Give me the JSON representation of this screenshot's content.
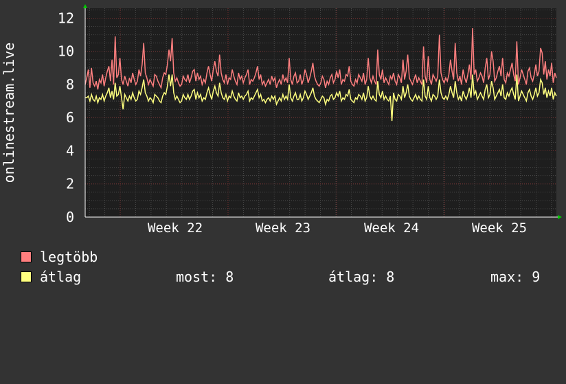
{
  "colors": {
    "background": "#333333",
    "plot_background": "#1e1e1e",
    "grid_minor": "#4a4a4a",
    "grid_major": "#7a3030",
    "axis_arrow": "#00cc00",
    "series_max": "#ff7f7f",
    "series_avg": "#ffff7f"
  },
  "legend": {
    "max_label": "legtöbb",
    "avg_label": "átlag",
    "stats": [
      {
        "label": "most: 8"
      },
      {
        "label": "átlag: 8"
      },
      {
        "label": "max: 9"
      }
    ]
  },
  "chart_data": {
    "type": "line",
    "xlabel": "",
    "ylabel": "onlinestream.live",
    "ylim": [
      0,
      12.6
    ],
    "yticks": [
      "0",
      "2",
      "4",
      "6",
      "8",
      "10",
      "12"
    ],
    "xticks": [
      "Week 22",
      "Week 23",
      "Week 24",
      "Week 25"
    ],
    "grid": true,
    "series": [
      {
        "name": "legtöbb",
        "values": [
          8,
          8.4,
          8.9,
          7.8,
          9,
          8.1,
          7.9,
          8.2,
          7.7,
          8.3,
          8.1,
          8.6,
          7.9,
          8.4,
          8.8,
          9.1,
          8.2,
          9.5,
          8.0,
          10.9,
          8.4,
          8.6,
          9.6,
          8.3,
          8.0,
          8.5,
          8.2,
          7.9,
          8.4,
          8.1,
          8.7,
          8.3,
          8.0,
          8.2,
          8.9,
          8.5,
          9.2,
          10.5,
          8.7,
          8.4,
          8.0,
          8.3,
          8.1,
          7.9,
          8.6,
          8.5,
          8.2,
          8.0,
          7.8,
          8.4,
          8.7,
          8.6,
          9.2,
          10.1,
          9.4,
          10.8,
          8.7,
          8.2,
          8.4,
          8.1,
          7.9,
          8.0,
          8.5,
          8.3,
          8.2,
          8.6,
          8.1,
          8.4,
          8.8,
          8.9,
          8.2,
          8.7,
          8.3,
          8.5,
          8.0,
          8.3,
          8.1,
          8.7,
          9.1,
          8.6,
          8.2,
          8.9,
          9.4,
          8.8,
          8.5,
          9.8,
          8.7,
          8.3,
          8.1,
          8.6,
          8.0,
          8.4,
          8.3,
          8.9,
          8.5,
          8.2,
          8.0,
          8.7,
          8.3,
          8.5,
          8.1,
          8.4,
          8.6,
          8.9,
          8.0,
          8.3,
          8.2,
          8.4,
          8.7,
          9.1,
          8.3,
          8.6,
          8.0,
          8.2,
          7.9,
          8.1,
          8.3,
          8.0,
          8.5,
          8.2,
          8.4,
          7.8,
          8.1,
          8.3,
          8.0,
          8.6,
          8.2,
          8.4,
          8.1,
          9.6,
          8.3,
          8.0,
          8.5,
          8.7,
          8.1,
          8.2,
          8.6,
          8.0,
          8.3,
          8.9,
          8.6,
          8.1,
          8.4,
          8.8,
          9.3,
          8.5,
          8.2,
          8.0,
          7.9,
          8.1,
          8.5,
          8.3,
          7.8,
          8.2,
          8.0,
          8.4,
          8.6,
          8.1,
          8.3,
          8.8,
          8.4,
          8.9,
          8.0,
          8.3,
          8.2,
          8.6,
          8.5,
          9.1,
          8.2,
          8.0,
          7.9,
          8.3,
          8.1,
          8.6,
          8.4,
          8.2,
          8.7,
          8.0,
          8.3,
          9.6,
          8.4,
          8.1,
          8.5,
          8.2,
          8.0,
          10.1,
          8.6,
          8.3,
          8.9,
          8.1,
          8.4,
          8.2,
          8.0,
          8.5,
          8.3,
          8.7,
          8.2,
          8.0,
          8.6,
          8.4,
          8.1,
          9.5,
          8.3,
          8.8,
          9.8,
          8.4,
          8.2,
          8.0,
          8.3,
          8.6,
          8.1,
          8.4,
          8.2,
          8.0,
          10.3,
          8.5,
          8.1,
          9.7,
          8.3,
          8.0,
          8.6,
          8.4,
          8.2,
          8.5,
          11.0,
          8.7,
          8.3,
          8.1,
          8.4,
          8.2,
          8.6,
          9.5,
          8.8,
          8.3,
          10.5,
          8.7,
          8.2,
          8.5,
          8.0,
          8.9,
          8.4,
          8.1,
          8.6,
          9.2,
          8.3,
          11.4,
          8.6,
          8.9,
          8.2,
          8.4,
          8.7,
          8.5,
          8.1,
          9.0,
          9.6,
          8.3,
          8.6,
          10.0,
          9.4,
          8.2,
          8.4,
          8.8,
          9.1,
          8.5,
          9.6,
          8.3,
          8.1,
          8.7,
          8.5,
          8.9,
          9.3,
          8.6,
          8.2,
          10.6,
          8.0,
          8.4,
          8.9,
          8.6,
          8.3,
          8.0,
          8.8,
          9.0,
          8.4,
          8.2,
          8.6,
          9.2,
          8.5,
          8.8,
          10.2,
          9.9,
          8.6,
          9.4,
          8.3,
          8.9,
          8.5,
          9.3,
          8.1,
          8.7,
          8.4
        ]
      },
      {
        "name": "átlag",
        "values": [
          7.2,
          7.2,
          7.3,
          7.0,
          7.4,
          7.1,
          7.0,
          7.3,
          6.9,
          7.2,
          7.1,
          7.4,
          7.0,
          7.3,
          7.5,
          7.8,
          7.2,
          7.6,
          7.1,
          8.1,
          7.3,
          7.4,
          7.9,
          7.2,
          6.5,
          7.4,
          7.2,
          7.0,
          7.3,
          7.1,
          7.5,
          7.2,
          7.0,
          7.1,
          7.6,
          7.4,
          7.8,
          8.3,
          7.5,
          7.3,
          7.0,
          7.2,
          7.1,
          6.9,
          7.4,
          7.3,
          7.2,
          7.0,
          6.9,
          7.3,
          7.5,
          7.4,
          7.9,
          8.6,
          7.9,
          8.6,
          7.5,
          7.1,
          7.3,
          7.1,
          6.9,
          7.0,
          7.4,
          7.2,
          7.1,
          7.4,
          7.1,
          7.3,
          7.6,
          7.7,
          7.1,
          7.5,
          7.2,
          7.4,
          7.0,
          7.2,
          7.1,
          7.5,
          7.8,
          7.4,
          7.1,
          7.6,
          7.9,
          7.5,
          7.3,
          8.1,
          7.5,
          7.2,
          7.1,
          7.4,
          7.0,
          7.3,
          7.2,
          7.6,
          7.3,
          7.1,
          7.0,
          7.5,
          7.2,
          7.3,
          7.1,
          7.3,
          7.4,
          7.6,
          7.0,
          7.2,
          7.1,
          7.3,
          7.5,
          7.7,
          7.2,
          7.4,
          7.0,
          7.1,
          6.9,
          7.1,
          7.2,
          7.0,
          7.3,
          7.1,
          7.3,
          6.8,
          7.0,
          7.2,
          7.0,
          7.4,
          7.1,
          7.3,
          7.1,
          8.0,
          7.2,
          7.0,
          7.3,
          7.5,
          7.1,
          7.1,
          7.4,
          7.0,
          7.2,
          7.6,
          7.4,
          7.1,
          7.3,
          7.5,
          7.8,
          7.3,
          7.1,
          7.0,
          6.9,
          7.1,
          7.3,
          7.2,
          6.8,
          7.1,
          7.0,
          7.3,
          7.4,
          7.1,
          7.2,
          7.5,
          7.3,
          7.6,
          7.0,
          7.2,
          7.1,
          7.4,
          7.3,
          7.7,
          7.1,
          7.0,
          6.9,
          7.2,
          7.1,
          7.4,
          7.3,
          7.1,
          7.5,
          7.0,
          7.2,
          7.9,
          7.3,
          7.1,
          7.3,
          7.1,
          7.0,
          8.2,
          7.4,
          7.2,
          7.6,
          7.1,
          7.3,
          7.1,
          7.0,
          7.3,
          5.8,
          7.5,
          7.1,
          7.0,
          7.4,
          7.3,
          7.1,
          7.9,
          7.2,
          7.5,
          8.0,
          7.3,
          7.1,
          7.0,
          7.2,
          7.4,
          7.1,
          7.3,
          7.1,
          7.0,
          8.3,
          7.3,
          7.1,
          7.9,
          7.2,
          7.0,
          7.4,
          7.3,
          7.1,
          7.3,
          8.3,
          7.5,
          7.2,
          7.1,
          7.3,
          7.1,
          7.4,
          7.9,
          7.5,
          7.2,
          8.2,
          7.5,
          7.1,
          7.3,
          7.0,
          7.6,
          7.3,
          7.1,
          7.4,
          7.8,
          7.2,
          8.6,
          7.4,
          7.6,
          7.1,
          7.3,
          7.5,
          7.3,
          7.1,
          7.7,
          8.0,
          7.2,
          7.4,
          8.2,
          7.8,
          7.1,
          7.3,
          7.5,
          7.7,
          7.3,
          8.0,
          7.2,
          7.1,
          7.5,
          7.3,
          7.6,
          7.8,
          7.4,
          7.1,
          8.6,
          7.0,
          7.3,
          7.6,
          7.4,
          7.2,
          7.0,
          7.5,
          7.7,
          7.3,
          7.1,
          7.4,
          7.8,
          7.3,
          7.5,
          8.3,
          8.1,
          7.4,
          7.8,
          7.2,
          7.6,
          7.3,
          7.8,
          7.1,
          7.5,
          7.3
        ]
      }
    ]
  }
}
